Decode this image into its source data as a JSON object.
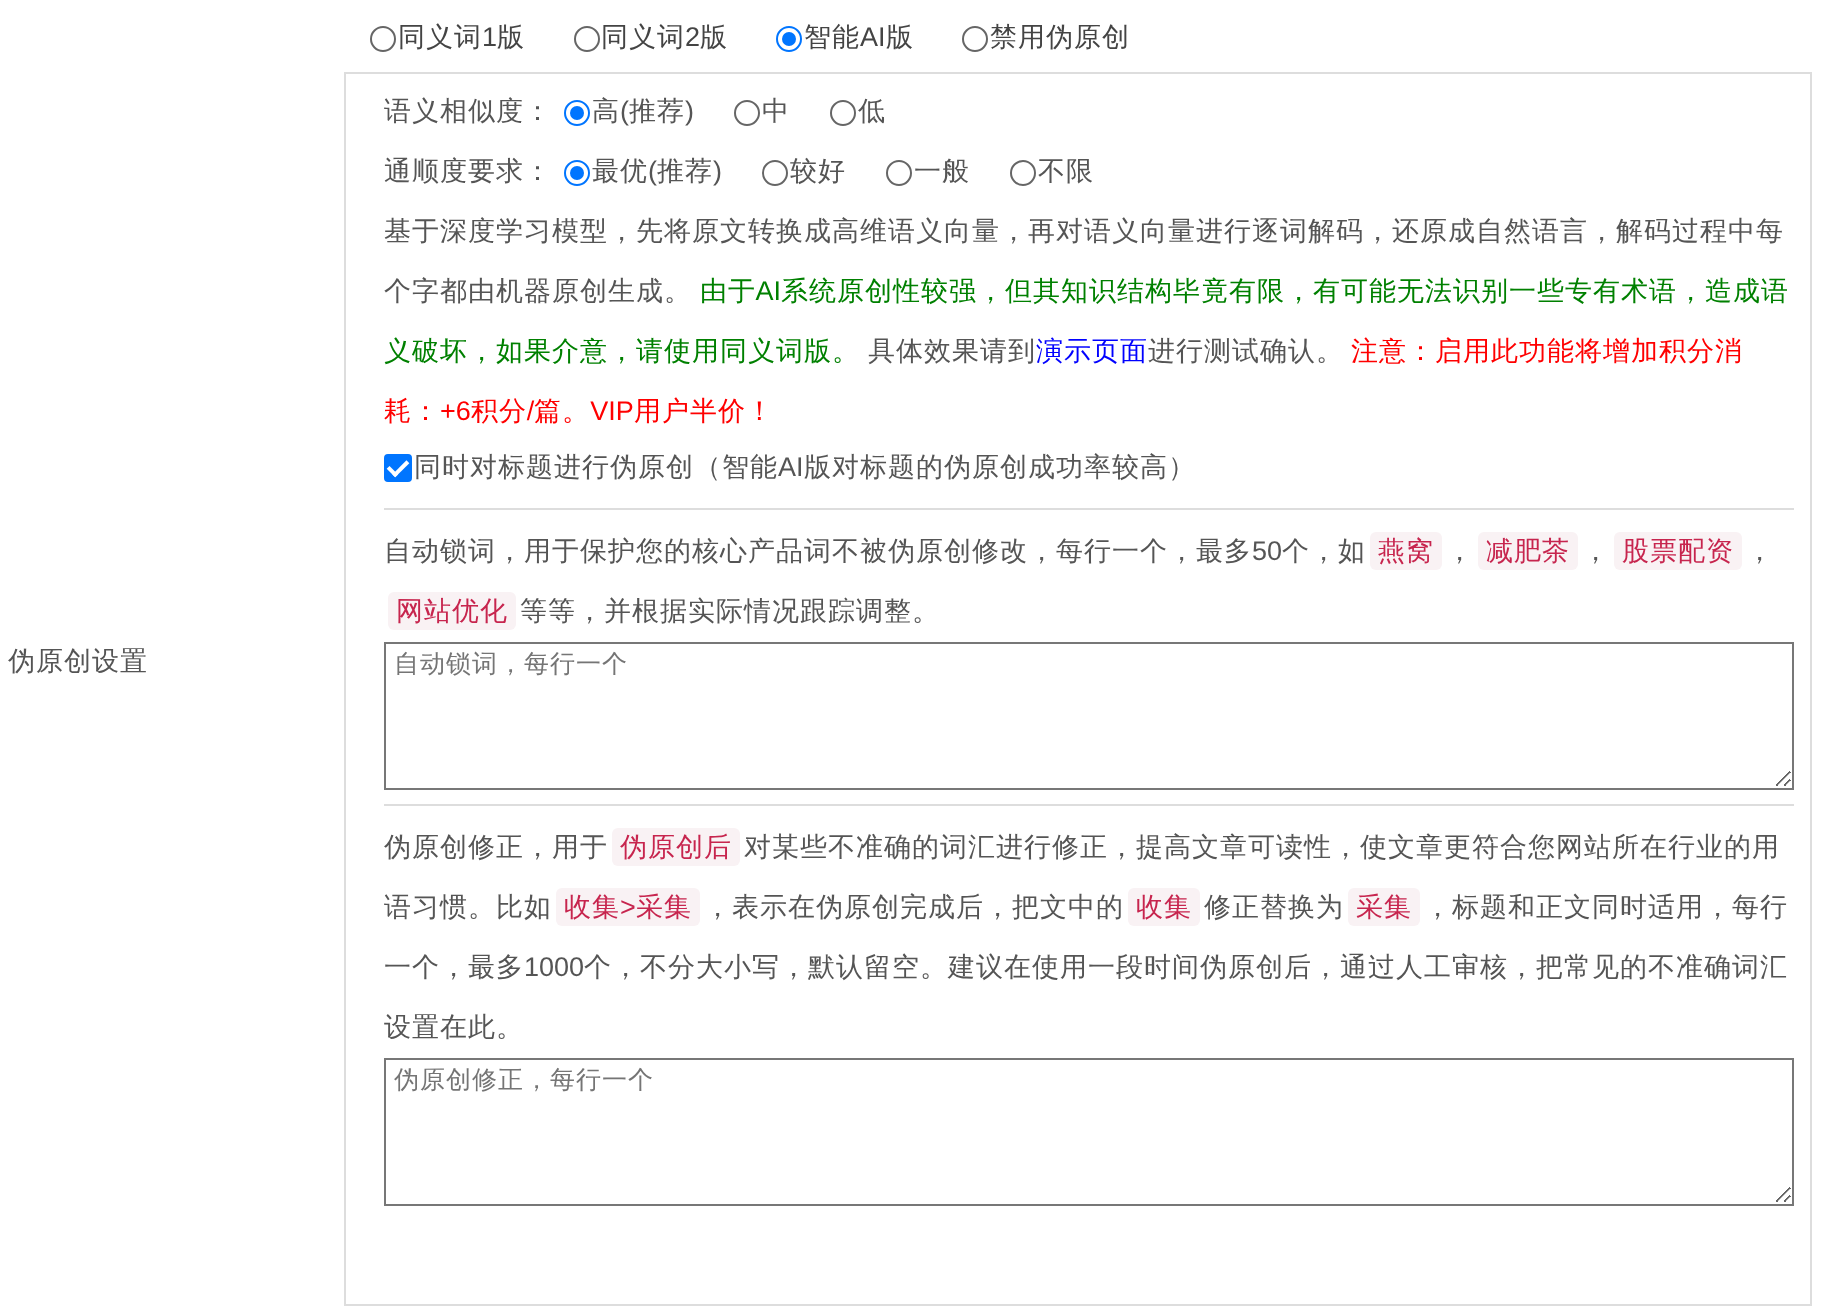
{
  "section_label": "伪原创设置",
  "modes": [
    {
      "label": "同义词1版",
      "selected": false
    },
    {
      "label": "同义词2版",
      "selected": false
    },
    {
      "label": "智能AI版",
      "selected": true
    },
    {
      "label": "禁用伪原创",
      "selected": false
    }
  ],
  "similarity": {
    "label": "语义相似度：",
    "options": [
      {
        "label": "高(推荐)",
        "selected": true
      },
      {
        "label": "中",
        "selected": false
      },
      {
        "label": "低",
        "selected": false
      }
    ]
  },
  "fluency": {
    "label": "通顺度要求：",
    "options": [
      {
        "label": "最优(推荐)",
        "selected": true
      },
      {
        "label": "较好",
        "selected": false
      },
      {
        "label": "一般",
        "selected": false
      },
      {
        "label": "不限",
        "selected": false
      }
    ]
  },
  "ai_description": [
    {
      "kind": "text",
      "text": "基于深度学习模型，先将原文转换成高维语义向量，再对语义向量进行逐词解码，还原成自然语言，解码过程中每个字都由机器原创生成。 "
    },
    {
      "kind": "notice",
      "text": "由于AI系统原创性较强，但其知识结构毕竟有限，有可能无法识别一些专有术语，造成语义破坏，如果介意，请使用同义词版。"
    },
    {
      "kind": "text",
      "text": " 具体效果请到"
    },
    {
      "kind": "link",
      "text": "演示页面"
    },
    {
      "kind": "text",
      "text": "进行测试确认。 "
    },
    {
      "kind": "warning",
      "text": "注意：启用此功能将增加积分消耗：+6积分/篇。VIP用户半价！"
    }
  ],
  "title_option": {
    "label": "同时对标题进行伪原创（智能AI版对标题的伪原创成功率较高）",
    "checked": true
  },
  "lock_words": {
    "description": [
      {
        "kind": "text",
        "text": "自动锁词，用于保护您的核心产品词不被伪原创修改，每行一个，最多50个，如"
      },
      {
        "kind": "code",
        "text": "燕窝"
      },
      {
        "kind": "text",
        "text": "，"
      },
      {
        "kind": "code",
        "text": "减肥茶"
      },
      {
        "kind": "text",
        "text": "，"
      },
      {
        "kind": "code",
        "text": "股票配资"
      },
      {
        "kind": "text",
        "text": "，"
      },
      {
        "kind": "code",
        "text": "网站优化"
      },
      {
        "kind": "text",
        "text": "等等，并根据实际情况跟踪调整。"
      }
    ],
    "placeholder": "自动锁词，每行一个"
  },
  "correction": {
    "description": [
      {
        "kind": "text",
        "text": "伪原创修正，用于"
      },
      {
        "kind": "code",
        "text": "伪原创后"
      },
      {
        "kind": "text",
        "text": "对某些不准确的词汇进行修正，提高文章可读性，使文章更符合您网站所在行业的用语习惯。比如"
      },
      {
        "kind": "code",
        "text": "收集>采集"
      },
      {
        "kind": "text",
        "text": "，表示在伪原创完成后，把文中的"
      },
      {
        "kind": "code",
        "text": "收集"
      },
      {
        "kind": "text",
        "text": "修正替换为"
      },
      {
        "kind": "code",
        "text": "采集"
      },
      {
        "kind": "text",
        "text": "，标题和正文同时适用，每行一个，最多1000个，不分大小写，默认留空。建议在使用一段时间伪原创后，通过人工审核，把常见的不准确词汇设置在此。"
      }
    ],
    "placeholder": "伪原创修正，每行一个"
  }
}
